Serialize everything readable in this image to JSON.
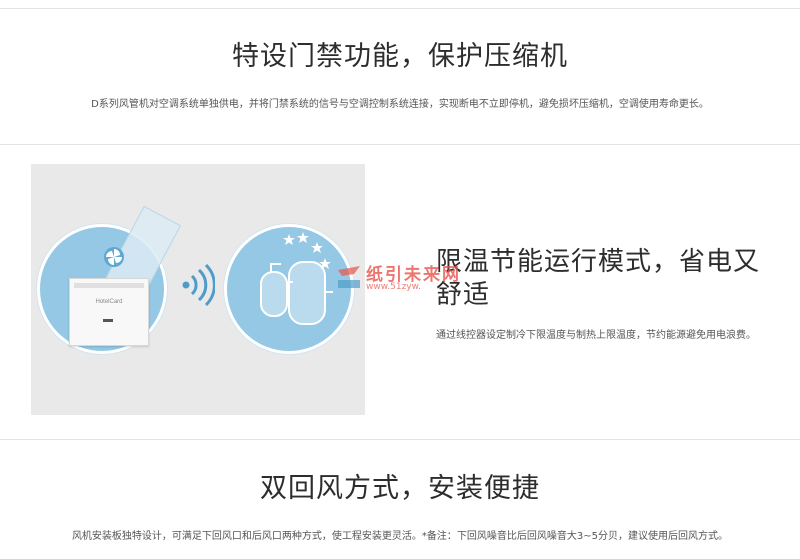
{
  "section_door": {
    "title": "特设门禁功能，保护压缩机",
    "description": "D系列风管机对空调系统单独供电，并将门禁系统的信号与空调控制系统连接，实现断电不立即停机，避免损坏压缩机，空调使用寿命更长。"
  },
  "illustration": {
    "card_label": "HotelCard",
    "icons": [
      "keycard-holder-icon",
      "fan-icon",
      "wireless-signal-icon",
      "compressor-icon",
      "star-icon"
    ],
    "circle_color": "#94c8e4",
    "panel_color": "#e9e9e9"
  },
  "section_temp": {
    "title": "限温节能运行模式，省电又舒适",
    "description": "通过线控器设定制冷下限温度与制热上限温度，节约能源避免用电浪费。"
  },
  "watermark": {
    "text": "纸引未来网",
    "url": "www.51zyw.",
    "color": "#e8544c"
  },
  "section_return": {
    "title": "双回风方式，安装便捷",
    "description": "风机安装板独特设计，可满足下回风口和后风口两种方式，使工程安装更灵活。*备注：下回风噪音比后回风噪音大3~5分贝，建议使用后回风方式。"
  }
}
